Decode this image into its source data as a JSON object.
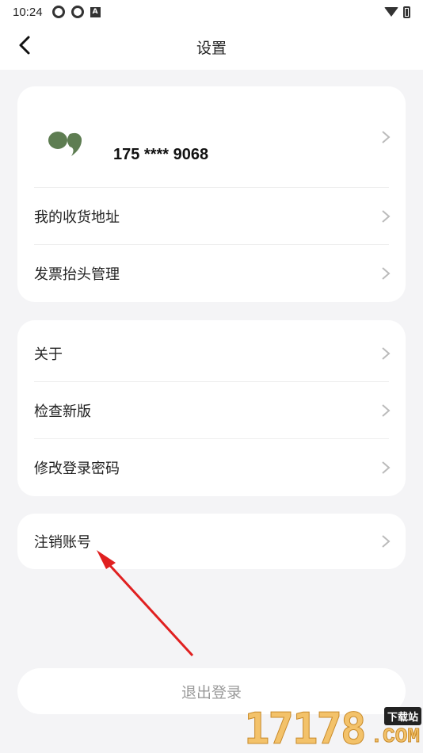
{
  "status_bar": {
    "time": "10:24"
  },
  "nav": {
    "title": "设置"
  },
  "account": {
    "phone": "175 **** 9068"
  },
  "group1": [
    {
      "label": "我的收货地址"
    },
    {
      "label": "发票抬头管理"
    }
  ],
  "group2": [
    {
      "label": "关于"
    },
    {
      "label": "检查新版"
    },
    {
      "label": "修改登录密码"
    }
  ],
  "group3": [
    {
      "label": "注销账号"
    }
  ],
  "logout_label": "退出登录",
  "watermark": {
    "digits": "17178",
    "tag": "下载站",
    "suffix": ".COM"
  },
  "colors": {
    "avatar": "#5e7d52",
    "annotation_arrow": "#e02020",
    "watermark": "#f3c26a"
  }
}
